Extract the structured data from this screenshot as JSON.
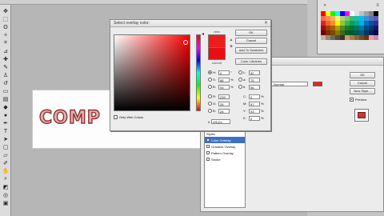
{
  "toolbar": {
    "tools": [
      {
        "icon": "move-icon",
        "glyph": "✥"
      },
      {
        "icon": "marquee-icon",
        "glyph": "⬚"
      },
      {
        "icon": "lasso-icon",
        "glyph": "ʘ"
      },
      {
        "icon": "magic-wand-icon",
        "glyph": "✧"
      },
      {
        "icon": "crop-icon",
        "glyph": "⌗"
      },
      {
        "icon": "slice-icon",
        "glyph": "⊿"
      },
      {
        "icon": "healing-brush-icon",
        "glyph": "✚"
      },
      {
        "icon": "brush-icon",
        "glyph": "✎"
      },
      {
        "icon": "clone-stamp-icon",
        "glyph": "♙"
      },
      {
        "icon": "history-brush-icon",
        "glyph": "↺"
      },
      {
        "icon": "eraser-icon",
        "glyph": "▭"
      },
      {
        "icon": "gradient-icon",
        "glyph": "▤"
      },
      {
        "icon": "blur-icon",
        "glyph": "◆"
      },
      {
        "icon": "dodge-icon",
        "glyph": "●"
      },
      {
        "icon": "pen-icon",
        "glyph": "✒"
      },
      {
        "icon": "type-icon",
        "glyph": "T"
      },
      {
        "icon": "path-selection-icon",
        "glyph": "➤"
      },
      {
        "icon": "shape-icon",
        "glyph": "▢"
      },
      {
        "icon": "notes-icon",
        "glyph": "▱"
      },
      {
        "icon": "eyedropper-icon",
        "glyph": "✐"
      },
      {
        "icon": "hand-icon",
        "glyph": "✋"
      },
      {
        "icon": "zoom-icon",
        "glyph": "⌕"
      },
      {
        "icon": "foreground-background-colors-icon",
        "glyph": "◩"
      },
      {
        "icon": "quick-mask-icon",
        "glyph": "◎"
      },
      {
        "icon": "screen-mode-icon",
        "glyph": "▣"
      }
    ]
  },
  "canvas": {
    "art_text": "COMP"
  },
  "color_picker": {
    "title": "Select overlay color:",
    "close_glyph": "✕",
    "new_label": "new",
    "current_label": "current",
    "new_color": "#ef1c1c",
    "current_color": "#e61010",
    "buttons": {
      "ok": "OK",
      "cancel": "Cancel",
      "add_to_swatches": "Add To Swatches",
      "color_libraries": "Color Libraries"
    },
    "fields": [
      {
        "label": "H:",
        "value": "0",
        "unit": "°",
        "selected": true
      },
      {
        "label": "S:",
        "value": "88",
        "unit": "%",
        "selected": false
      },
      {
        "label": "B:",
        "value": "93",
        "unit": "%",
        "selected": false
      },
      {
        "label": "R:",
        "value": "239",
        "unit": "",
        "selected": false
      },
      {
        "label": "G:",
        "value": "28",
        "unit": "",
        "selected": false
      },
      {
        "label": "B:",
        "value": "28",
        "unit": "",
        "selected": false
      }
    ],
    "lab_fields": [
      {
        "label": "L:",
        "value": "52"
      },
      {
        "label": "a:",
        "value": "75"
      },
      {
        "label": "b:",
        "value": "56"
      },
      {
        "label": "C:",
        "value": "0",
        "unit": "%"
      },
      {
        "label": "M:",
        "value": "97",
        "unit": "%"
      },
      {
        "label": "Y:",
        "value": "93",
        "unit": "%"
      },
      {
        "label": "K:",
        "value": "0",
        "unit": "%"
      }
    ],
    "only_web_colors": "Only Web Colors",
    "hex_label": "#",
    "hex_value": "ef1c1c"
  },
  "layer_style": {
    "blend_mode": "Normal",
    "overlay_color": "#e52222",
    "styles": [
      {
        "label": "Styles",
        "selected": false
      },
      {
        "label": "Color Overlay",
        "selected": true
      },
      {
        "label": "Gradient Overlay",
        "selected": false
      },
      {
        "label": "Pattern Overlay",
        "selected": false
      },
      {
        "label": "Stroke",
        "selected": false
      }
    ],
    "buttons": {
      "ok": "OK",
      "cancel": "Cancel",
      "new_style": "New Style...",
      "preview": "Preview"
    }
  },
  "swatches": {
    "colors": [
      "#ff0000",
      "#ffff00",
      "#00ff00",
      "#00ffff",
      "#0000ff",
      "#ff00ff",
      "#ffffff",
      "#e0e0e0",
      "#c0c0c0",
      "#a0a0a0",
      "#808080",
      "#000000",
      "#f26c4f",
      "#f68e55",
      "#fbaf5c",
      "#fff467",
      "#acd372",
      "#7cc576",
      "#3bb878",
      "#1abbb4",
      "#00bff3",
      "#438cca",
      "#5574b9",
      "#605ca8",
      "#ed1c24",
      "#f26522",
      "#f7941d",
      "#fff200",
      "#8dc63f",
      "#39b54a",
      "#00a651",
      "#00a99d",
      "#00aeef",
      "#0072bc",
      "#0054a6",
      "#2e3192",
      "#9e0b0f",
      "#a0410d",
      "#a36209",
      "#aba000",
      "#598527",
      "#1a7b30",
      "#007236",
      "#00746b",
      "#0076a3",
      "#004b80",
      "#003471",
      "#1b1464",
      "#790000",
      "#7b2e00",
      "#7d4900",
      "#827b00",
      "#406618",
      "#005e20",
      "#005826",
      "#005952",
      "#005b7f",
      "#003663",
      "#002157",
      "#0d004c",
      "#c7b299",
      "#998675",
      "#736357",
      "#534741",
      "#37302d",
      "#c69c6d",
      "#a67c52",
      "#8c6239",
      "#754c24",
      "#603913",
      "#f5989d",
      "#bd8cbf"
    ]
  }
}
